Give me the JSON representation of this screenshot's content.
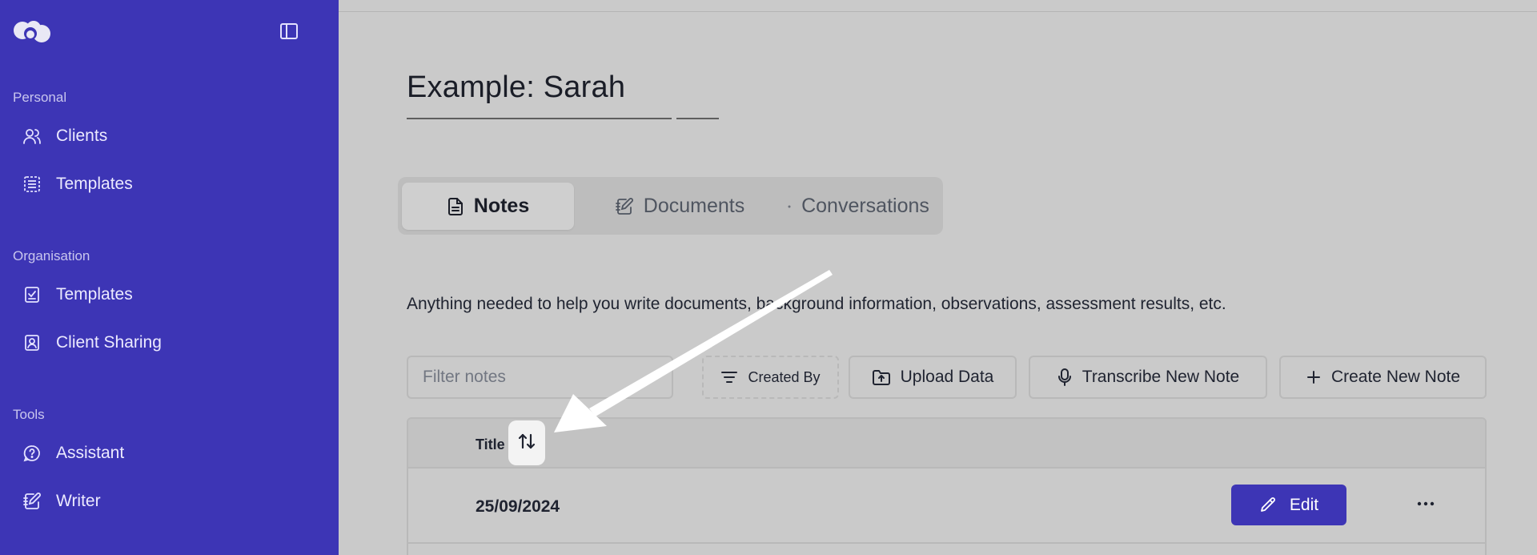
{
  "sidebar": {
    "sections": [
      {
        "label": "Personal",
        "items": [
          {
            "label": "Clients",
            "icon": "users-icon"
          },
          {
            "label": "Templates",
            "icon": "list-icon"
          }
        ]
      },
      {
        "label": "Organisation",
        "items": [
          {
            "label": "Templates",
            "icon": "checklist-icon"
          },
          {
            "label": "Client Sharing",
            "icon": "contact-book-icon"
          }
        ]
      },
      {
        "label": "Tools",
        "items": [
          {
            "label": "Assistant",
            "icon": "help-chat-icon"
          },
          {
            "label": "Writer",
            "icon": "notebook-pen-icon"
          }
        ]
      }
    ]
  },
  "page": {
    "title": "Example: Sarah",
    "description": "Anything needed to help you write documents, background information, observations, assessment results, etc."
  },
  "tabs": [
    {
      "label": "Notes",
      "active": true,
      "icon": "file-text-icon"
    },
    {
      "label": "Documents",
      "active": false,
      "icon": "notebook-pen-icon"
    },
    {
      "label": "Conversations",
      "active": false,
      "icon": ""
    }
  ],
  "toolbar": {
    "filter_placeholder": "Filter notes",
    "created_by_label": "Created By",
    "upload_label": "Upload Data",
    "transcribe_label": "Transcribe New Note",
    "create_label": "Create New Note"
  },
  "table": {
    "column_title": "Title",
    "rows": [
      {
        "title": "25/09/2024",
        "edit_label": "Edit"
      }
    ]
  },
  "colors": {
    "sidebar": "#3d35b5",
    "accent": "#3d35b5",
    "background": "#cacaca"
  }
}
